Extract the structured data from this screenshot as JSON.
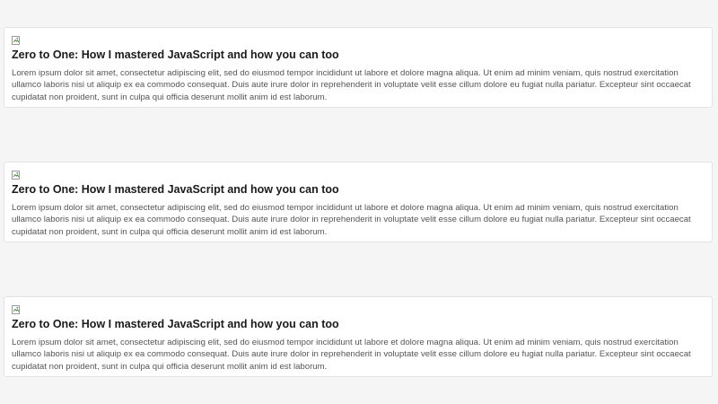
{
  "feed": {
    "cards": [
      {
        "image_icon": "broken-image-icon",
        "title": "Zero to One: How I mastered JavaScript and how you can too",
        "body": "Lorem ipsum dolor sit amet, consectetur adipiscing elit, sed do eiusmod tempor incididunt ut labore et dolore magna aliqua. Ut enim ad minim veniam, quis nostrud exercitation ullamco laboris nisi ut aliquip ex ea commodo consequat. Duis aute irure dolor in reprehenderit in voluptate velit esse cillum dolore eu fugiat nulla pariatur. Excepteur sint occaecat cupidatat non proident, sunt in culpa qui officia deserunt mollit anim id est laborum."
      },
      {
        "image_icon": "broken-image-icon",
        "title": "Zero to One: How I mastered JavaScript and how you can too",
        "body": "Lorem ipsum dolor sit amet, consectetur adipiscing elit, sed do eiusmod tempor incididunt ut labore et dolore magna aliqua. Ut enim ad minim veniam, quis nostrud exercitation ullamco laboris nisi ut aliquip ex ea commodo consequat. Duis aute irure dolor in reprehenderit in voluptate velit esse cillum dolore eu fugiat nulla pariatur. Excepteur sint occaecat cupidatat non proident, sunt in culpa qui officia deserunt mollit anim id est laborum."
      },
      {
        "image_icon": "broken-image-icon",
        "title": "Zero to One: How I mastered JavaScript and how you can too",
        "body": "Lorem ipsum dolor sit amet, consectetur adipiscing elit, sed do eiusmod tempor incididunt ut labore et dolore magna aliqua. Ut enim ad minim veniam, quis nostrud exercitation ullamco laboris nisi ut aliquip ex ea commodo consequat. Duis aute irure dolor in reprehenderit in voluptate velit esse cillum dolore eu fugiat nulla pariatur. Excepteur sint occaecat cupidatat non proident, sunt in culpa qui officia deserunt mollit anim id est laborum."
      }
    ]
  },
  "colors": {
    "page_background": "#f5f5f5",
    "card_background": "#ffffff",
    "card_border": "#e3e3e3",
    "title_text": "#1a1a1a",
    "body_text": "#555555"
  }
}
